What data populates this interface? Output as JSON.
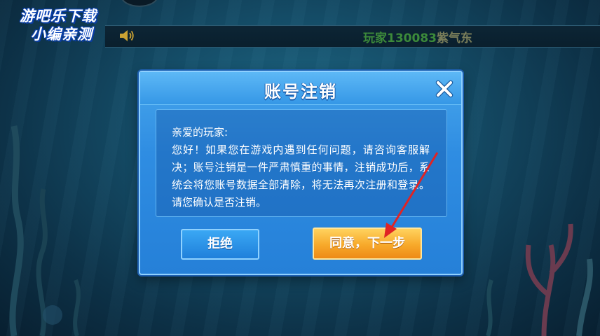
{
  "logo": {
    "line1": "游吧乐下载",
    "line2": "小编亲测"
  },
  "ticker": {
    "prefix": "玩家130083",
    "name": "紫气东"
  },
  "dialog": {
    "title": "账号注销",
    "close_icon": "close-icon",
    "greeting": "亲爱的玩家:",
    "body": "您好！如果您在游戏内遇到任何问题，请咨询客服解决；账号注销是一件严肃慎重的事情，注销成功后，系统会将您账号数据全部清除，将无法再次注册和登录。请您确认是否注销。",
    "refuse_label": "拒绝",
    "agree_label": "同意，下一步"
  },
  "colors": {
    "dialog_blue": "#2f8de2",
    "agree_orange": "#f7a92a",
    "arrow_red": "#e02424",
    "ticker_green": "#3c8a3a"
  }
}
